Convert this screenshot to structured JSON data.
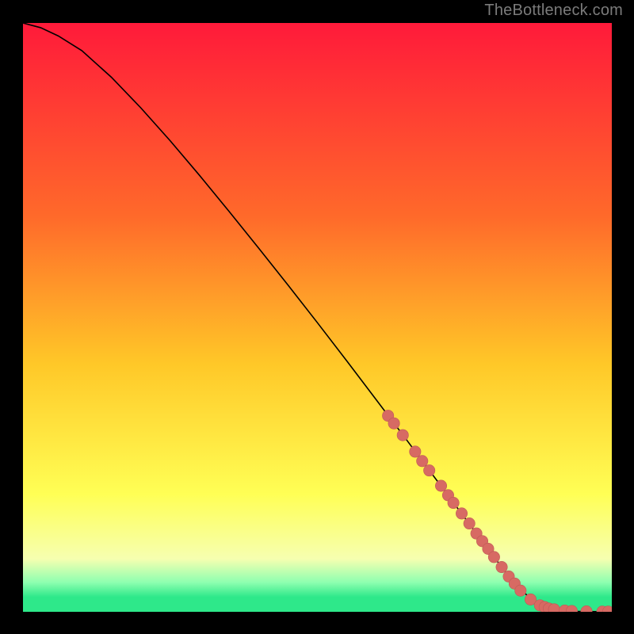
{
  "watermark": "TheBottleneck.com",
  "colors": {
    "background": "#000000",
    "gradient_top": "#ff1a3a",
    "gradient_mid1": "#ff6a2a",
    "gradient_mid2": "#ffc828",
    "gradient_mid3": "#ffff55",
    "gradient_mid4": "#f6ffb0",
    "gradient_bot1": "#8effb0",
    "gradient_bot2": "#2ee88a",
    "curve": "#000000",
    "marker_fill": "#d76a63",
    "marker_stroke": "#bf5a55",
    "watermark": "#7b7b7b"
  },
  "chart_data": {
    "type": "line",
    "title": "",
    "xlabel": "",
    "ylabel": "",
    "xlim": [
      0,
      100
    ],
    "ylim": [
      0,
      100
    ],
    "series": [
      {
        "name": "curve",
        "x": [
          0,
          3,
          6,
          10,
          15,
          20,
          25,
          30,
          35,
          40,
          45,
          50,
          55,
          60,
          65,
          70,
          75,
          80,
          83,
          86,
          88,
          90,
          92,
          94,
          96,
          98,
          100
        ],
        "y": [
          100,
          99.2,
          97.8,
          95.3,
          90.8,
          85.6,
          80.0,
          74.1,
          68.0,
          61.8,
          55.5,
          49.1,
          42.6,
          36.0,
          29.4,
          22.7,
          16.0,
          9.3,
          5.4,
          2.4,
          1.1,
          0.45,
          0.18,
          0.07,
          0.04,
          0.03,
          0.03
        ]
      }
    ],
    "markers": [
      {
        "x": 62.0,
        "y": 33.3
      },
      {
        "x": 63.0,
        "y": 32.0
      },
      {
        "x": 64.5,
        "y": 30.0
      },
      {
        "x": 66.6,
        "y": 27.2
      },
      {
        "x": 67.8,
        "y": 25.6
      },
      {
        "x": 69.0,
        "y": 24.0
      },
      {
        "x": 71.0,
        "y": 21.4
      },
      {
        "x": 72.2,
        "y": 19.8
      },
      {
        "x": 73.1,
        "y": 18.5
      },
      {
        "x": 74.5,
        "y": 16.7
      },
      {
        "x": 75.8,
        "y": 15.0
      },
      {
        "x": 77.0,
        "y": 13.3
      },
      {
        "x": 78.0,
        "y": 12.0
      },
      {
        "x": 79.0,
        "y": 10.7
      },
      {
        "x": 80.0,
        "y": 9.3
      },
      {
        "x": 81.3,
        "y": 7.6
      },
      {
        "x": 82.5,
        "y": 6.0
      },
      {
        "x": 83.5,
        "y": 4.8
      },
      {
        "x": 84.5,
        "y": 3.6
      },
      {
        "x": 86.2,
        "y": 2.1
      },
      {
        "x": 87.8,
        "y": 1.1
      },
      {
        "x": 88.6,
        "y": 0.8
      },
      {
        "x": 89.3,
        "y": 0.55
      },
      {
        "x": 90.2,
        "y": 0.42
      },
      {
        "x": 92.0,
        "y": 0.2
      },
      {
        "x": 93.2,
        "y": 0.13
      },
      {
        "x": 95.7,
        "y": 0.06
      },
      {
        "x": 98.4,
        "y": 0.03
      },
      {
        "x": 99.4,
        "y": 0.03
      }
    ],
    "marker_radius_px": 7.2
  }
}
